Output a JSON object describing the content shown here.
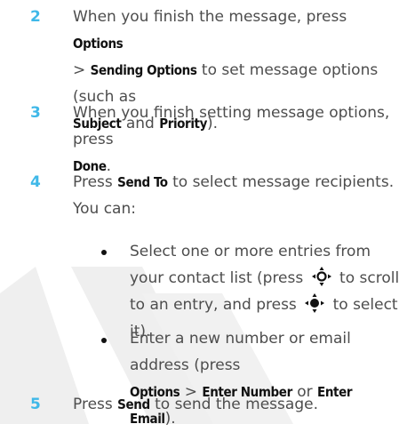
{
  "steps": [
    {
      "number": "2",
      "line1": "When you finish the message, press",
      "options": "Options",
      "gt1": ">",
      "sending_options": "Sending Options",
      "line2_rest": "to set message options (such as",
      "subject": "Subject",
      "and": "and",
      "priority": "Priority",
      "close": ")."
    },
    {
      "number": "3",
      "line1": "When you finish setting message options, press",
      "done": "Done",
      "period": "."
    },
    {
      "number": "4",
      "press": "Press",
      "send_to": "Send To",
      "rest": "to select message recipients. You can:"
    },
    {
      "number": "5",
      "press": "Press",
      "send": "Send",
      "rest": "to send the message."
    }
  ],
  "bullets": [
    {
      "part1": "Select one or more entries from your contact list (press",
      "part2": "to scroll to an entry, and press",
      "part3": "to select it).",
      "icon1": "nav-key-scroll-icon",
      "icon2": "nav-key-center-select-icon"
    },
    {
      "part1": "Enter a new number or email address (press",
      "options": "Options",
      "gt": ">",
      "enter_number": "Enter Number",
      "or": "or",
      "enter_email": "Enter Email",
      "close": ")."
    }
  ],
  "colors": {
    "step_number": "#3fb8e8",
    "body_text": "#4d4d4d",
    "key_text": "#111111",
    "watermark": "#ececec"
  }
}
